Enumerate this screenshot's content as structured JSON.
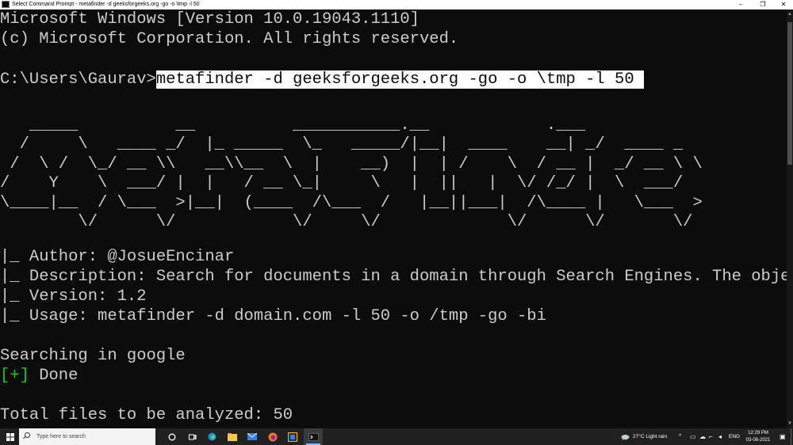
{
  "window": {
    "title": "Select Command Prompt - metafinder -d geeksforgeeks.org -go -o \\tmp -l 50",
    "controls": {
      "minimize": "–",
      "maximize": "❐",
      "close": "✕"
    }
  },
  "console": {
    "header_line1": "Microsoft Windows [Version 10.0.19043.1110]",
    "header_line2": "(c) Microsoft Corporation. All rights reserved.",
    "prompt": "C:\\Users\\Gaurav>",
    "command": "metafinder -d geeksforgeeks.org -go -o \\tmp -l 50 ",
    "banner_art": "   _____          __          ___________.__            .___\n  /     \\   ____ _/  |_ _____  \\_   _____/|__|  ____    __| _/  ____ _\n /  \\ /  \\_/ __ \\\\   __\\\\__  \\  |    __)  |  | /    \\  / __ |  _/ __ \\ \\\n/    Y    \\  ___/ |  |   / __ \\_|     \\   |  ||   |  \\/ /_/ |  \\  ___/\n\\____|__  / \\___  >|__|  (____  /\\___  /   |__||___|  /\\____ |   \\___  >\n        \\/      \\/            \\/     \\/             \\/      \\/       \\/",
    "info_author": "|_ Author: @JosueEncinar",
    "info_description": "|_ Description: Search for documents in a domain through Search Engines. The objective",
    "info_version": "|_ Version: 1.2",
    "info_usage": "|_ Usage: metafinder -d domain.com -l 50 -o /tmp -go -bi",
    "searching": "Searching in google",
    "done_marker": "[+]",
    "done_text": " Done",
    "total_files": "Total files to be analyzed: 50",
    "colors": {
      "background": "#0c0c0c",
      "text": "#cccccc",
      "success": "#16c60c",
      "selection": "#ffffff"
    }
  },
  "taskbar": {
    "start_icon": "windows-logo-icon",
    "search_placeholder": "Type here to search",
    "pinned": [
      "task-view-icon",
      "edge-icon",
      "file-explorer-icon",
      "mail-icon",
      "firefox-icon",
      "app-icon",
      "terminal-icon"
    ],
    "weather": "27°C  Light rain",
    "language": "ENG",
    "time": "12:29 PM",
    "date": "03-08-2021"
  }
}
